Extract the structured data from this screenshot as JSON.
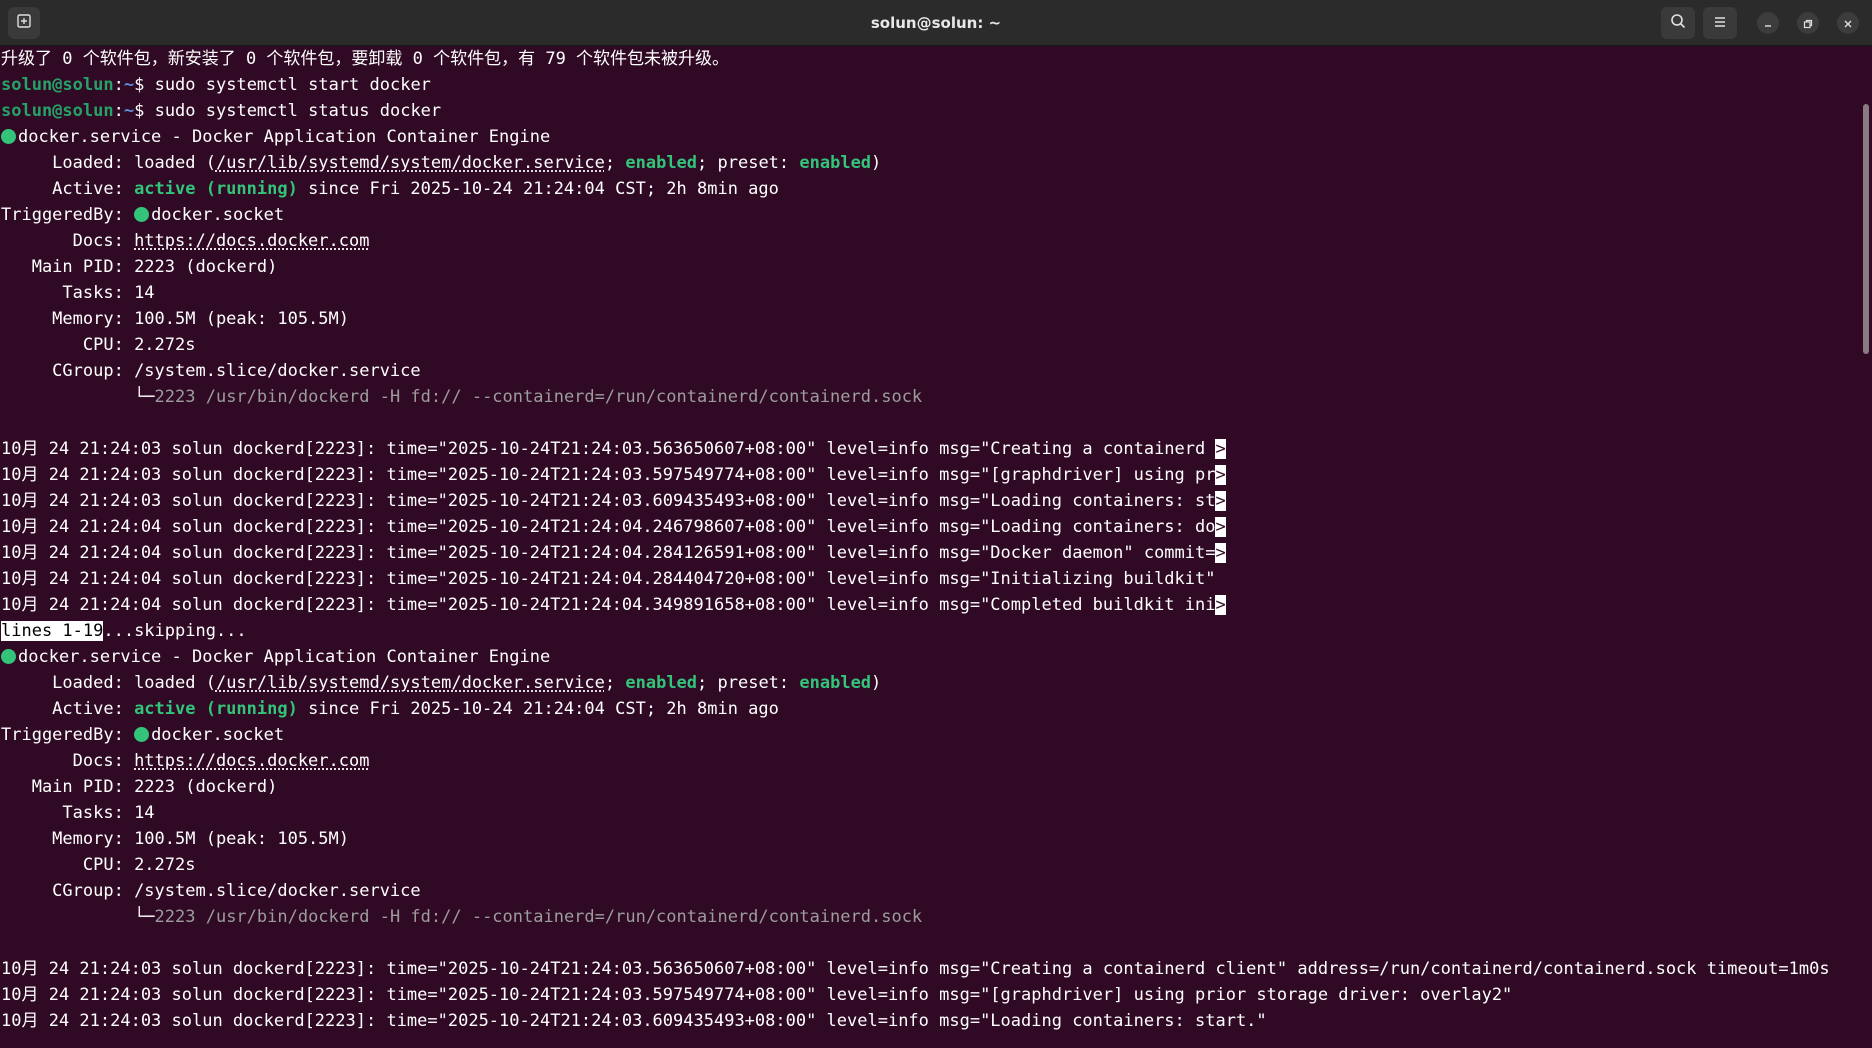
{
  "window": {
    "title": "solun@solun: ~",
    "icons": {
      "new_tab": "new-tab-icon",
      "search": "search-icon",
      "menu": "hamburger-menu-icon",
      "minimize": "minimize-icon",
      "maximize": "restore-icon",
      "close": "close-icon"
    }
  },
  "colors": {
    "background": "#300a24",
    "prompt_user": "#26a269",
    "prompt_path": "#5c8fd6",
    "status_green": "#33c47a"
  },
  "terminal": {
    "upgrade_msg": "升级了 0 个软件包，新安装了 0 个软件包，要卸载 0 个软件包，有 79 个软件包未被升级。",
    "prompt_user": "solun@solun",
    "prompt_sep": ":",
    "prompt_path": "~",
    "prompt_dollar": "$ ",
    "cmd1": "sudo systemctl start docker",
    "cmd2": "sudo systemctl status docker",
    "status": {
      "unit": "docker.service - Docker Application Container Engine",
      "loaded_label": "     Loaded: ",
      "loaded_prefix": "loaded (",
      "loaded_path": "/usr/lib/systemd/system/docker.service",
      "loaded_sep": "; ",
      "enabled1": "enabled",
      "preset_label": "; preset: ",
      "enabled2": "enabled",
      "loaded_suffix": ")",
      "active_label": "     Active: ",
      "active_value": "active (running)",
      "active_since": " since Fri 2025-10-24 21:24:04 CST; 2h 8min ago",
      "triggered_label": "TriggeredBy: ",
      "triggered_value": "docker.socket",
      "docs_label": "       Docs: ",
      "docs_url": "https://docs.docker.com",
      "pid_label": "   Main PID: ",
      "pid_value": "2223 (dockerd)",
      "tasks_label": "      Tasks: ",
      "tasks_value": "14",
      "memory_label": "     Memory: ",
      "memory_value": "100.5M (peak: 105.5M)",
      "cpu_label": "        CPU: ",
      "cpu_value": "2.272s",
      "cgroup_label": "     CGroup: ",
      "cgroup_value": "/system.slice/docker.service",
      "tree_indent": "             ",
      "tree_branch": "└─",
      "cgroup_proc": "2223 /usr/bin/dockerd -H fd:// --containerd=/run/containerd/containerd.sock"
    },
    "logs_truncated": [
      {
        "text": "10月 24 21:24:03 solun dockerd[2223]: time=\"2025-10-24T21:24:03.563650607+08:00\" level=info msg=\"Creating a containerd ",
        "marker": ">"
      },
      {
        "text": "10月 24 21:24:03 solun dockerd[2223]: time=\"2025-10-24T21:24:03.597549774+08:00\" level=info msg=\"[graphdriver] using pr",
        "marker": ">"
      },
      {
        "text": "10月 24 21:24:03 solun dockerd[2223]: time=\"2025-10-24T21:24:03.609435493+08:00\" level=info msg=\"Loading containers: st",
        "marker": ">"
      },
      {
        "text": "10月 24 21:24:04 solun dockerd[2223]: time=\"2025-10-24T21:24:04.246798607+08:00\" level=info msg=\"Loading containers: do",
        "marker": ">"
      },
      {
        "text": "10月 24 21:24:04 solun dockerd[2223]: time=\"2025-10-24T21:24:04.284126591+08:00\" level=info msg=\"Docker daemon\" commit=",
        "marker": ">"
      },
      {
        "text": "10月 24 21:24:04 solun dockerd[2223]: time=\"2025-10-24T21:24:04.284404720+08:00\" level=info msg=\"Initializing buildkit\"",
        "marker": ""
      },
      {
        "text": "10月 24 21:24:04 solun dockerd[2223]: time=\"2025-10-24T21:24:04.349891658+08:00\" level=info msg=\"Completed buildkit ini",
        "marker": ">"
      }
    ],
    "pager_status": "lines 1-19",
    "pager_skip": "...skipping...",
    "logs_full": [
      "10月 24 21:24:03 solun dockerd[2223]: time=\"2025-10-24T21:24:03.563650607+08:00\" level=info msg=\"Creating a containerd client\" address=/run/containerd/containerd.sock timeout=1m0s",
      "10月 24 21:24:03 solun dockerd[2223]: time=\"2025-10-24T21:24:03.597549774+08:00\" level=info msg=\"[graphdriver] using prior storage driver: overlay2\"",
      "10月 24 21:24:03 solun dockerd[2223]: time=\"2025-10-24T21:24:03.609435493+08:00\" level=info msg=\"Loading containers: start.\""
    ]
  }
}
